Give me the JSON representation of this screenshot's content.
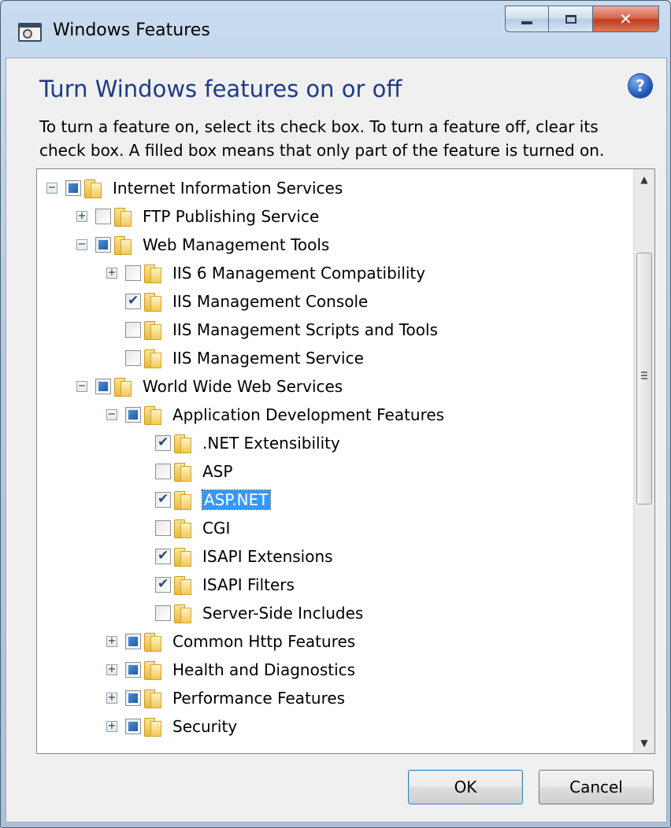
{
  "window": {
    "title": "Windows Features"
  },
  "dialog": {
    "heading": "Turn Windows features on or off",
    "help_glyph": "?",
    "description": "To turn a feature on, select its check box. To turn a feature off, clear its check box. A filled box means that only part of the feature is turned on."
  },
  "tree": {
    "items": [
      {
        "label": "Internet Information Services",
        "level": 0,
        "expander": "minus",
        "state": "partial"
      },
      {
        "label": "FTP Publishing Service",
        "level": 1,
        "expander": "plus",
        "state": "unchecked"
      },
      {
        "label": "Web Management Tools",
        "level": 1,
        "expander": "minus",
        "state": "partial"
      },
      {
        "label": "IIS 6 Management Compatibility",
        "level": 2,
        "expander": "plus",
        "state": "unchecked"
      },
      {
        "label": "IIS Management Console",
        "level": 2,
        "expander": "none",
        "state": "checked"
      },
      {
        "label": "IIS Management Scripts and Tools",
        "level": 2,
        "expander": "none",
        "state": "unchecked"
      },
      {
        "label": "IIS Management Service",
        "level": 2,
        "expander": "none",
        "state": "unchecked"
      },
      {
        "label": "World Wide Web Services",
        "level": 1,
        "expander": "minus",
        "state": "partial"
      },
      {
        "label": "Application Development Features",
        "level": 2,
        "expander": "minus",
        "state": "partial"
      },
      {
        "label": ".NET Extensibility",
        "level": 3,
        "expander": "none",
        "state": "checked"
      },
      {
        "label": "ASP",
        "level": 3,
        "expander": "none",
        "state": "unchecked"
      },
      {
        "label": "ASP.NET",
        "level": 3,
        "expander": "none",
        "state": "checked",
        "selected": true
      },
      {
        "label": "CGI",
        "level": 3,
        "expander": "none",
        "state": "unchecked"
      },
      {
        "label": "ISAPI Extensions",
        "level": 3,
        "expander": "none",
        "state": "checked"
      },
      {
        "label": "ISAPI Filters",
        "level": 3,
        "expander": "none",
        "state": "checked"
      },
      {
        "label": "Server-Side Includes",
        "level": 3,
        "expander": "none",
        "state": "unchecked"
      },
      {
        "label": "Common Http Features",
        "level": 2,
        "expander": "plus",
        "state": "partial"
      },
      {
        "label": "Health and Diagnostics",
        "level": 2,
        "expander": "plus",
        "state": "partial"
      },
      {
        "label": "Performance Features",
        "level": 2,
        "expander": "plus",
        "state": "partial"
      },
      {
        "label": "Security",
        "level": 2,
        "expander": "plus",
        "state": "partial"
      }
    ]
  },
  "buttons": {
    "ok": "OK",
    "cancel": "Cancel"
  }
}
